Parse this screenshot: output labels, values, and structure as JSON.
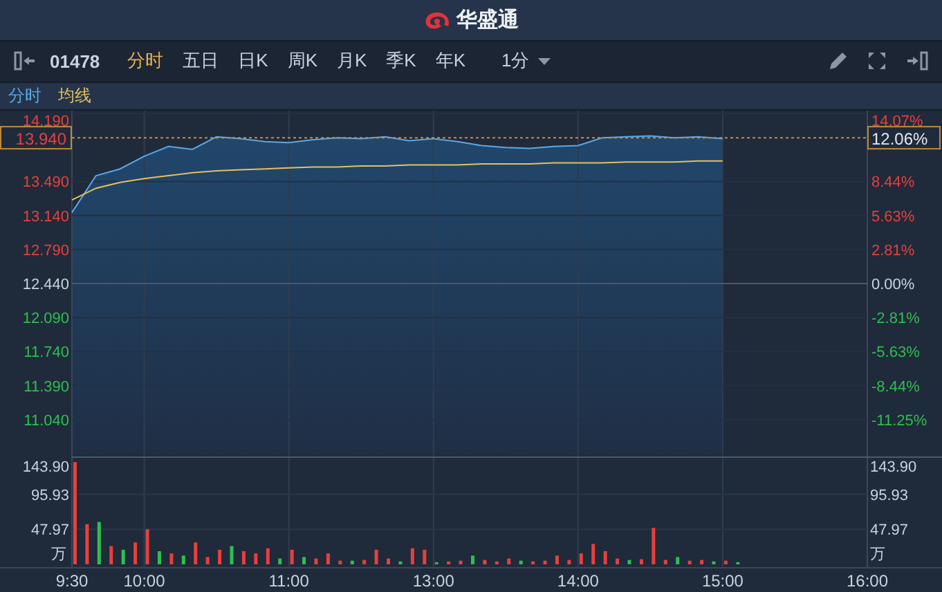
{
  "header": {
    "logo_text": "华盛通"
  },
  "toolbar": {
    "code": "01478",
    "tabs": [
      {
        "label": "分时",
        "selected": true
      },
      {
        "label": "五日",
        "selected": false
      },
      {
        "label": "日K",
        "selected": false
      },
      {
        "label": "周K",
        "selected": false
      },
      {
        "label": "月K",
        "selected": false
      },
      {
        "label": "季K",
        "selected": false
      },
      {
        "label": "年K",
        "selected": false
      }
    ],
    "interval": "1分"
  },
  "price_chart": {
    "chart_data": {
      "type": "line",
      "grid": true,
      "ylim": [
        10.69,
        14.19
      ],
      "yticks": [
        {
          "value": 14.19,
          "label": "14.190"
        },
        {
          "value": 13.49,
          "label": "13.490"
        },
        {
          "value": 13.14,
          "label": "13.140"
        },
        {
          "value": 12.79,
          "label": "12.790"
        },
        {
          "value": 12.44,
          "label": "12.440"
        },
        {
          "value": 12.09,
          "label": "12.090"
        },
        {
          "value": 11.74,
          "label": "11.740"
        },
        {
          "value": 11.39,
          "label": "11.390"
        },
        {
          "value": 11.04,
          "label": "11.040"
        }
      ],
      "categories": [
        null,
        null,
        null,
        null,
        null,
        null,
        null,
        null,
        null,
        null,
        null,
        null,
        null,
        null,
        null,
        null,
        null,
        null,
        null,
        null,
        null,
        null,
        null,
        null,
        null,
        null,
        null,
        null,
        null,
        null,
        null,
        null,
        null,
        null
      ],
      "series": [
        {
          "name": "分时",
          "color": "#5aa9e6",
          "values": [
            13.17,
            13.55,
            13.62,
            13.75,
            13.85,
            13.82,
            13.95,
            13.93,
            13.9,
            13.89,
            13.92,
            13.94,
            13.93,
            13.95,
            13.91,
            13.93,
            13.9,
            13.86,
            13.84,
            13.83,
            13.85,
            13.86,
            13.94,
            13.95,
            13.96,
            13.94,
            13.95,
            13.93,
            null,
            null,
            null,
            null,
            null,
            null
          ]
        },
        {
          "name": "均线",
          "color": "#e6c15a",
          "values": [
            13.3,
            13.42,
            13.48,
            13.52,
            13.55,
            13.58,
            13.6,
            13.61,
            13.62,
            13.63,
            13.64,
            13.64,
            13.65,
            13.65,
            13.66,
            13.66,
            13.66,
            13.67,
            13.67,
            13.67,
            13.68,
            13.68,
            13.68,
            13.69,
            13.69,
            13.69,
            13.7,
            13.7,
            null,
            null,
            null,
            null,
            null,
            null
          ]
        }
      ]
    },
    "percent_labels": [
      "14.07%",
      "8.44%",
      "5.63%",
      "2.81%",
      "0.00%",
      "-2.81%",
      "-5.63%",
      "-8.44%",
      "-11.25%"
    ],
    "crosshair": {
      "price": "13.940",
      "percent": "12.06%"
    }
  },
  "volume_chart": {
    "chart_data": {
      "type": "bar",
      "grid": true,
      "ylabel": "万",
      "ylim": [
        0,
        143.9
      ],
      "yticks": [
        {
          "value": 143.9,
          "label": "143.90"
        },
        {
          "value": 95.93,
          "label": "95.93"
        },
        {
          "value": 47.97,
          "label": "47.97"
        }
      ],
      "categories": [
        "9:30",
        null,
        null,
        null,
        null,
        null,
        "10:00",
        null,
        null,
        null,
        null,
        null,
        null,
        null,
        null,
        null,
        null,
        null,
        "11:00",
        null,
        null,
        null,
        null,
        null,
        null,
        null,
        null,
        null,
        null,
        null,
        "13:00",
        null,
        null,
        null,
        null,
        null,
        null,
        null,
        null,
        null,
        null,
        null,
        "14:00",
        null,
        null,
        null,
        null,
        null,
        null,
        null,
        null,
        null,
        null,
        null,
        "15:00",
        null,
        null,
        null,
        null,
        null,
        null,
        null,
        null,
        null,
        null,
        null,
        "16:00"
      ],
      "series": [
        {
          "color": "#e8403a",
          "values": [
            140,
            55,
            null,
            25,
            null,
            30,
            48,
            null,
            15,
            null,
            30,
            10,
            20,
            null,
            18,
            15,
            22,
            null,
            20,
            null,
            8,
            15,
            5,
            null,
            6,
            20,
            8,
            null,
            22,
            20,
            null,
            4,
            5,
            null,
            6,
            4,
            8,
            null,
            4,
            5,
            12,
            6,
            15,
            28,
            18,
            8,
            null,
            7,
            50,
            6,
            null,
            5,
            6,
            null,
            5,
            null,
            null,
            null,
            null,
            null,
            null,
            null,
            null,
            null,
            null,
            null,
            null
          ]
        },
        {
          "color": "#2fbf4f",
          "values": [
            null,
            null,
            58,
            null,
            20,
            null,
            null,
            18,
            null,
            12,
            null,
            null,
            null,
            25,
            null,
            null,
            null,
            8,
            null,
            10,
            null,
            null,
            null,
            5,
            null,
            null,
            null,
            4,
            null,
            null,
            3,
            null,
            null,
            12,
            null,
            null,
            null,
            5,
            null,
            null,
            null,
            null,
            null,
            null,
            null,
            null,
            6,
            null,
            null,
            null,
            10,
            null,
            null,
            4,
            null,
            3,
            null,
            null,
            null,
            null,
            null,
            null,
            null,
            null,
            null,
            null,
            null
          ]
        }
      ]
    },
    "right_labels": [
      "143.90",
      "95.93",
      "47.97"
    ],
    "right_unit": "万"
  }
}
